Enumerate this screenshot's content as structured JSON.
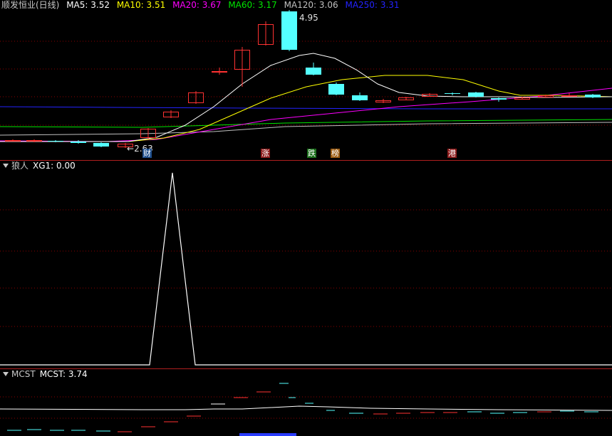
{
  "main": {
    "title": "顺发恒业(日线)",
    "indicators": [
      {
        "label": "MA5:",
        "value": "3.52",
        "color": "#ffffff"
      },
      {
        "label": "MA10:",
        "value": "3.51",
        "color": "#ffff00"
      },
      {
        "label": "MA20:",
        "value": "3.67",
        "color": "#ff00ff"
      },
      {
        "label": "MA60:",
        "value": "3.17",
        "color": "#00e600"
      },
      {
        "label": "MA120:",
        "value": "3.06",
        "color": "#c0c0c0"
      },
      {
        "label": "MA250:",
        "value": "3.31",
        "color": "#2323ff"
      }
    ],
    "high_label": "4.95",
    "low_label": "2.63",
    "badges": [
      {
        "text": "财",
        "bg": "#1e4e8c"
      },
      {
        "text": "涨",
        "bg": "#8b1a1a"
      },
      {
        "text": "跌",
        "bg": "#1a6e1a"
      },
      {
        "text": "榜",
        "bg": "#9a5a10"
      },
      {
        "text": "港",
        "bg": "#8b1a1a"
      }
    ]
  },
  "xg_panel": {
    "name": "狼人",
    "label": "XG1:",
    "value": "0.00"
  },
  "mcst_panel": {
    "name": "MCST",
    "label": "MCST:",
    "value": "3.74"
  },
  "colors": {
    "up": "#ff3232",
    "down": "#54ffff",
    "grid": "#8b0000",
    "separator": "#b01e1e"
  }
}
